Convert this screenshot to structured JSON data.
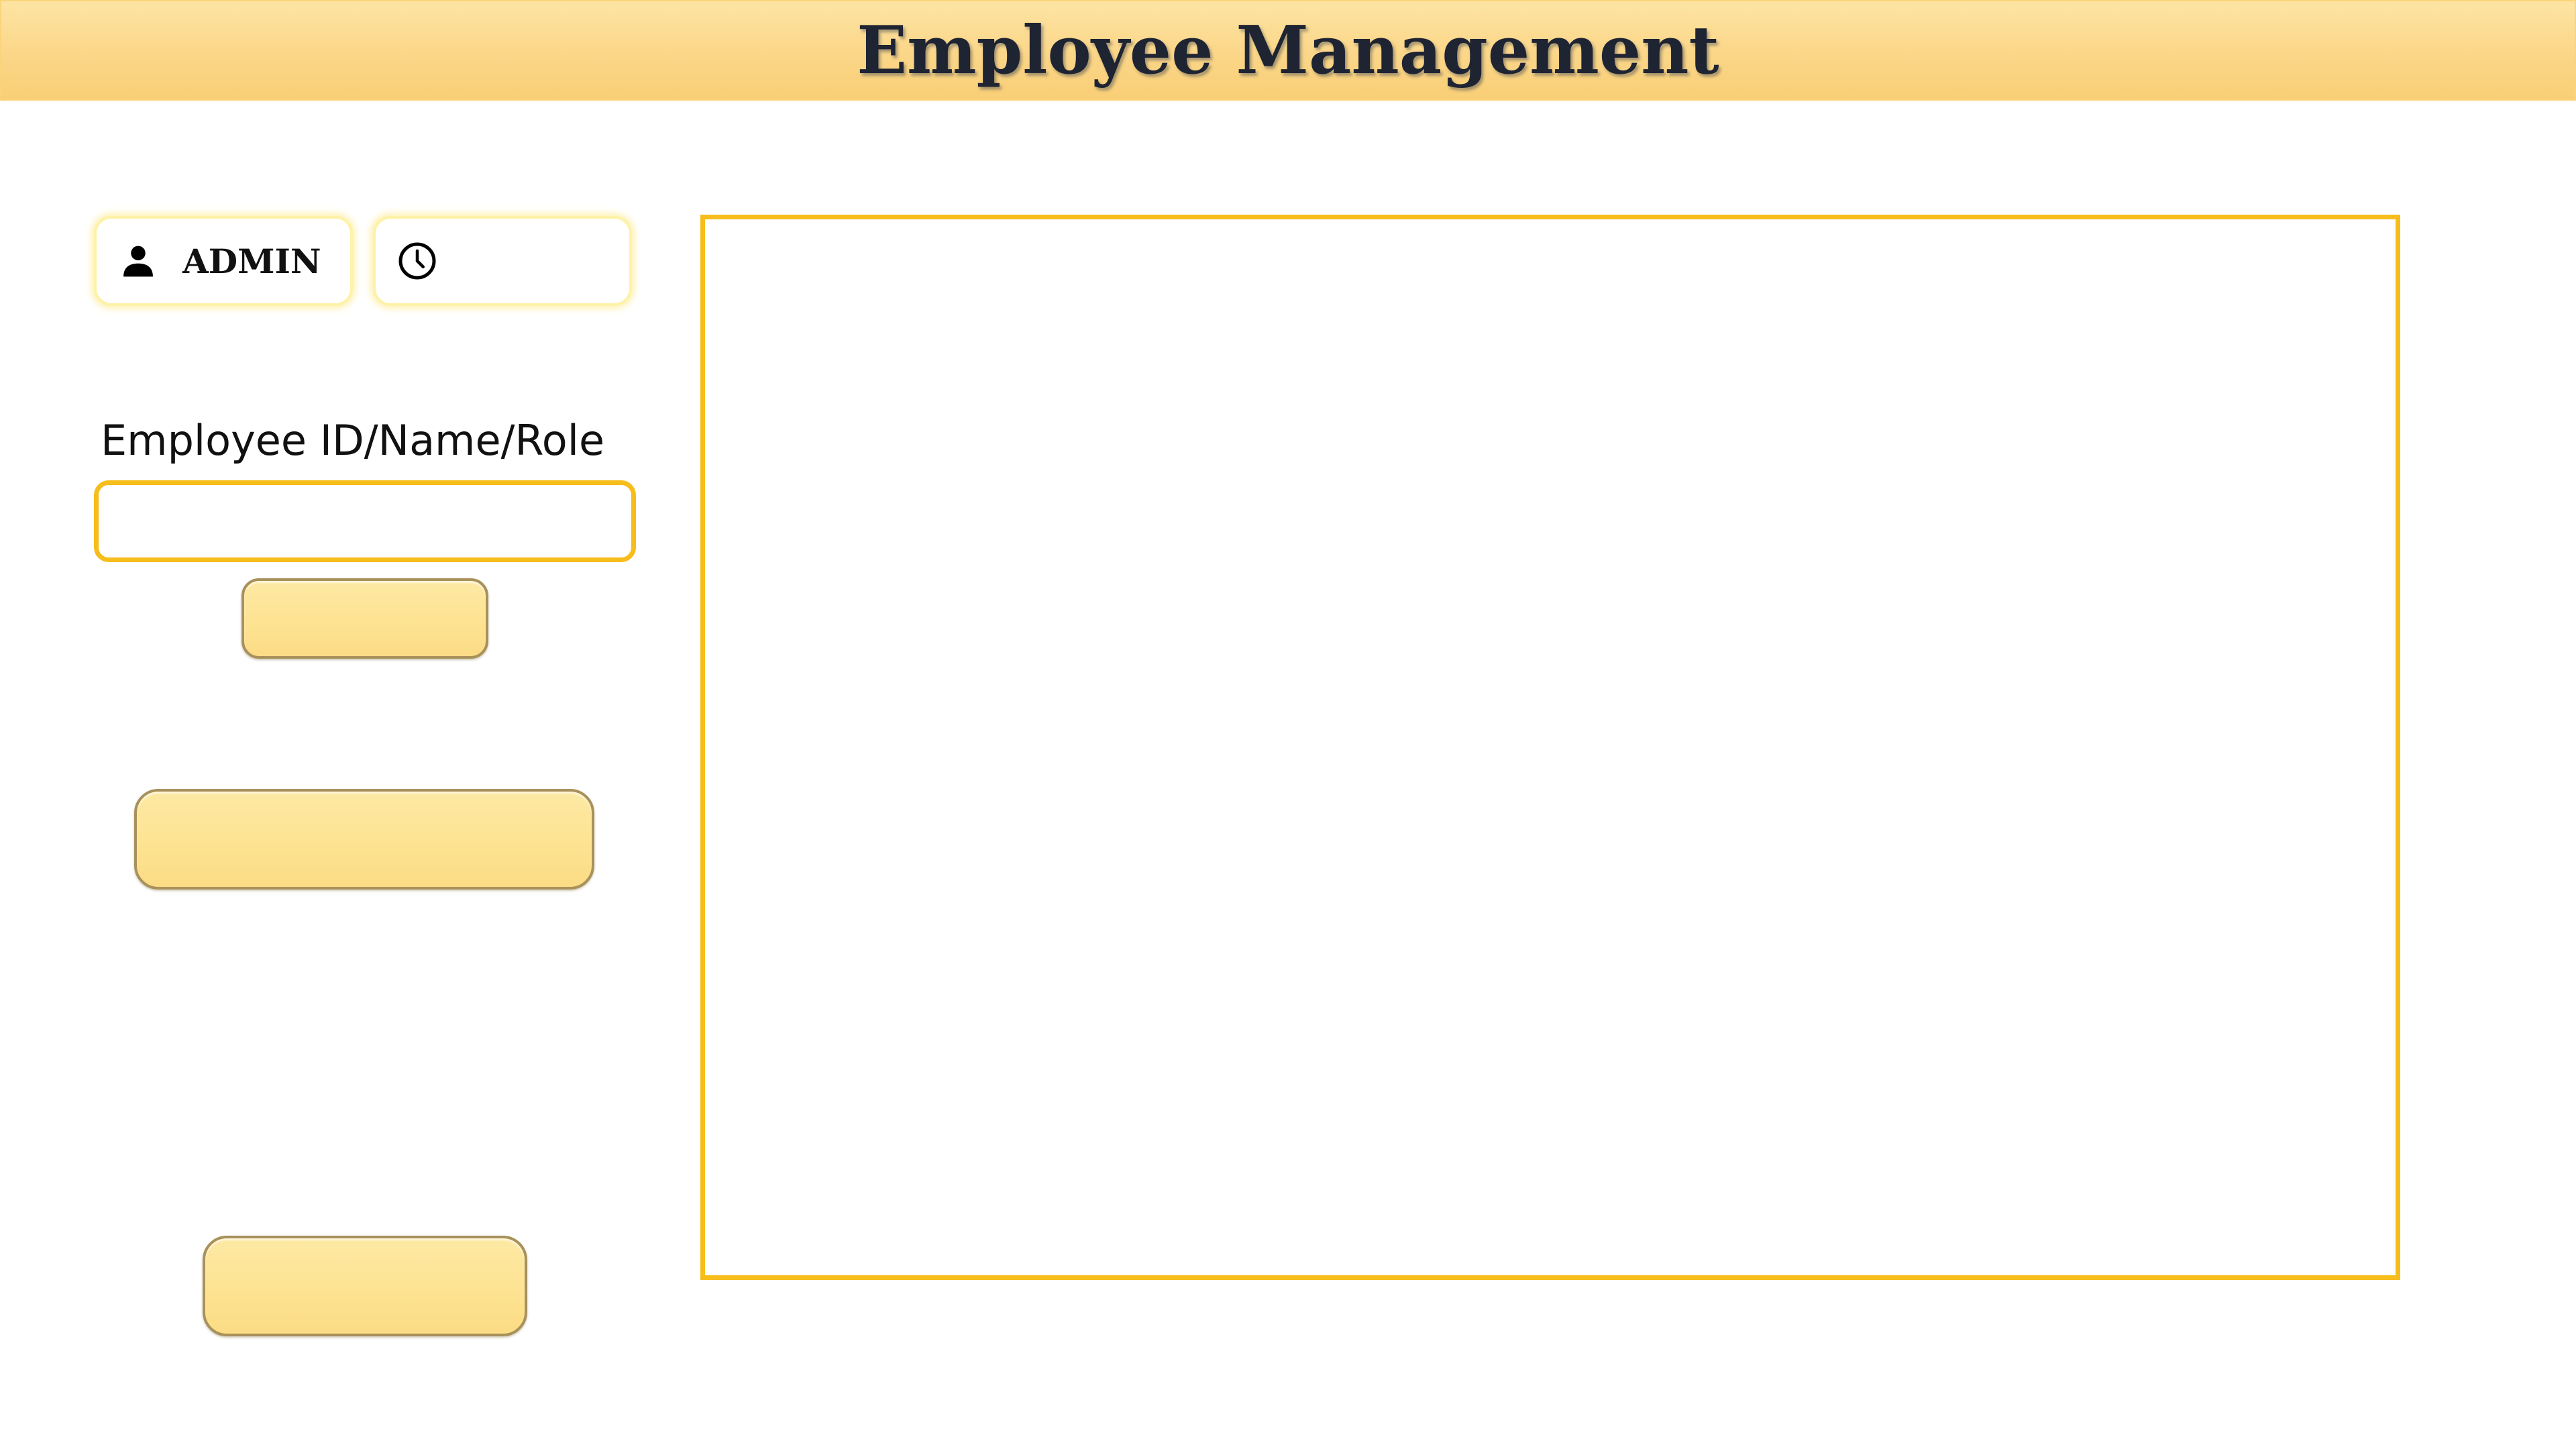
{
  "header": {
    "title": "Employee Management"
  },
  "user_chip": {
    "icon": "user-icon",
    "label": "ADMIN"
  },
  "clock_chip": {
    "icon": "clock-icon",
    "label": ""
  },
  "search": {
    "label": "Employee ID/Name/Role",
    "value": "",
    "placeholder": "",
    "button_label": ""
  },
  "actions": {
    "middle_button_label": "",
    "bottom_button_label": ""
  },
  "colors": {
    "header_gradient_top": "#fde4a3",
    "header_gradient_bottom": "#f9cf76",
    "accent_border": "#f6bd1c",
    "button_fill": "#fde290",
    "button_border": "#a8915a",
    "title_text": "#1f2433"
  }
}
